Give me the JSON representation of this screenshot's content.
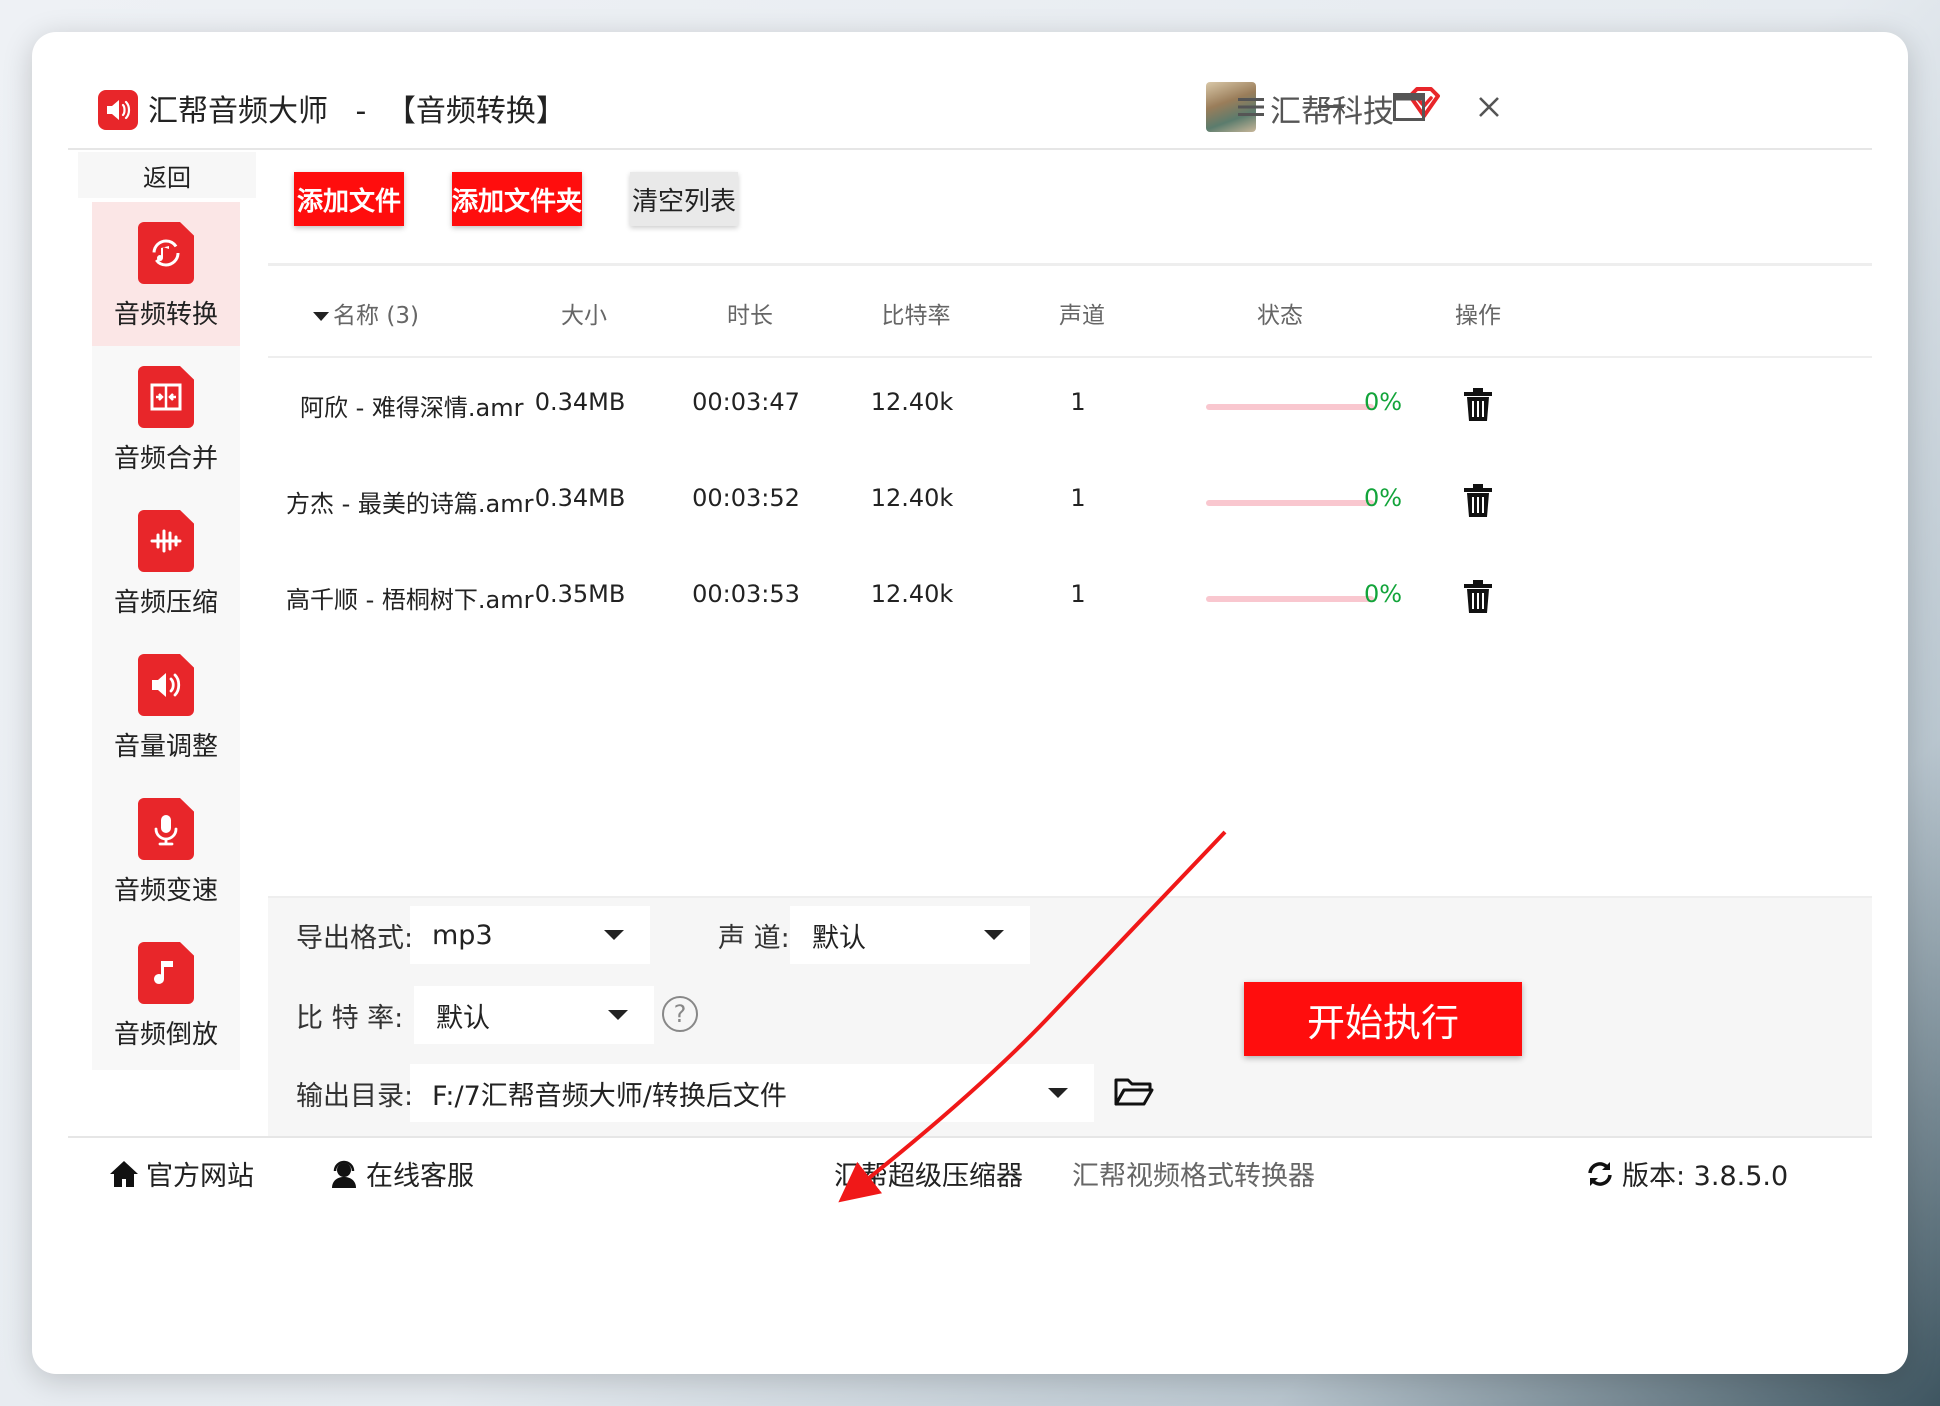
{
  "window": {
    "app_name": "汇帮音频大师",
    "separator": "-",
    "mode_title": "【音频转换】",
    "company": "汇帮科技"
  },
  "sidebar": {
    "back_label": "返回",
    "items": [
      {
        "label": "音频转换",
        "icon": "audio-convert-icon",
        "active": true
      },
      {
        "label": "音频合并",
        "icon": "audio-merge-icon",
        "active": false
      },
      {
        "label": "音频压缩",
        "icon": "audio-compress-icon",
        "active": false
      },
      {
        "label": "音量调整",
        "icon": "volume-adjust-icon",
        "active": false
      },
      {
        "label": "音频变速",
        "icon": "audio-speed-icon",
        "active": false
      },
      {
        "label": "音频倒放",
        "icon": "audio-reverse-icon",
        "active": false
      }
    ]
  },
  "toolbar": {
    "add_file": "添加文件",
    "add_folder": "添加文件夹",
    "clear_list": "清空列表"
  },
  "table": {
    "headers": {
      "name": "名称 (3)",
      "size": "大小",
      "duration": "时长",
      "bitrate": "比特率",
      "channels": "声道",
      "status": "状态",
      "action": "操作"
    },
    "rows": [
      {
        "name": "阿欣 - 难得深情.amr",
        "size": "0.34MB",
        "duration": "00:03:47",
        "bitrate": "12.40k",
        "channels": "1",
        "progress": 0,
        "progress_text": "0%"
      },
      {
        "name": "方杰 - 最美的诗篇.amr",
        "size": "0.34MB",
        "duration": "00:03:52",
        "bitrate": "12.40k",
        "channels": "1",
        "progress": 0,
        "progress_text": "0%"
      },
      {
        "name": "高千顺 - 梧桐树下.amr",
        "size": "0.35MB",
        "duration": "00:03:53",
        "bitrate": "12.40k",
        "channels": "1",
        "progress": 0,
        "progress_text": "0%"
      }
    ]
  },
  "settings": {
    "format_label": "导出格式:",
    "format_value": "mp3",
    "channel_label": "声 道:",
    "channel_value": "默认",
    "bitrate_label": "比 特 率:",
    "bitrate_value": "默认",
    "output_label": "输出目录:",
    "output_value": "F:/7汇帮音频大师/转换后文件",
    "start_button": "开始执行"
  },
  "footer": {
    "website": "官方网站",
    "support": "在线客服",
    "compressor": "汇帮超级压缩器",
    "video_converter": "汇帮视频格式转换器",
    "version": "版本: 3.8.5.0"
  },
  "colors": {
    "accent": "#ff0d0d",
    "progress_track": "#f9c7cf",
    "percent_text": "#12a43a",
    "active_sidebar_bg": "#fbe6e6"
  }
}
